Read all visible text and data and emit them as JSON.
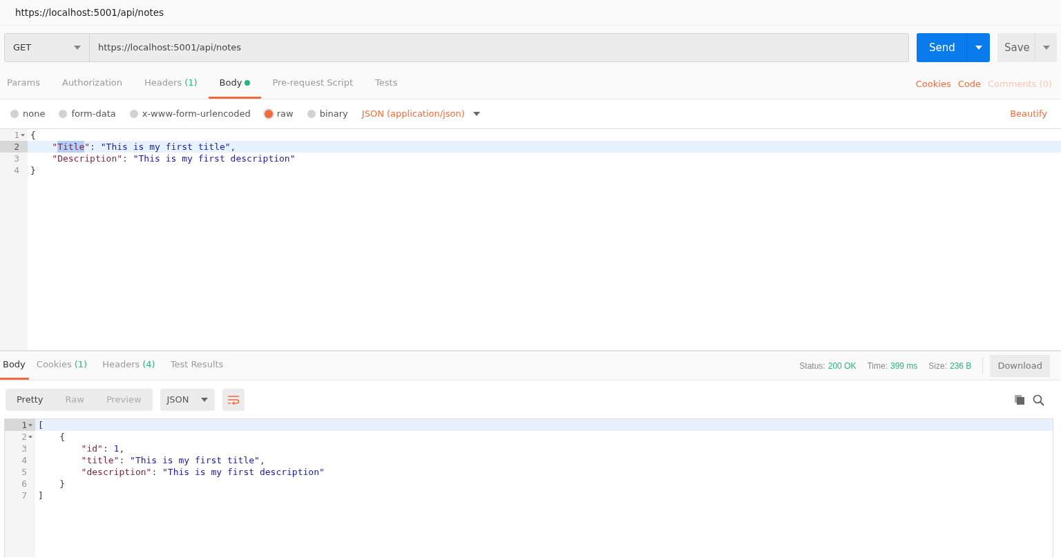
{
  "window": {
    "title": "https://localhost:5001/api/notes"
  },
  "request": {
    "method": "GET",
    "url": "https://localhost:5001/api/notes",
    "send": "Send",
    "save": "Save"
  },
  "request_tabs": [
    {
      "label": "Params",
      "selected": false,
      "dot": false
    },
    {
      "label": "Authorization",
      "selected": false,
      "dot": false
    },
    {
      "label": "Headers",
      "count": "(1)",
      "selected": false,
      "dot": false
    },
    {
      "label": "Body",
      "selected": true,
      "dot": true
    },
    {
      "label": "Pre-request Script",
      "selected": false,
      "dot": false
    },
    {
      "label": "Tests",
      "selected": false,
      "dot": false
    }
  ],
  "request_links": [
    {
      "label": "Cookies",
      "disabled": false
    },
    {
      "label": "Code",
      "disabled": false
    },
    {
      "label": "Comments (0)",
      "disabled": true
    }
  ],
  "body_types": [
    {
      "label": "none",
      "selected": false
    },
    {
      "label": "form-data",
      "selected": false
    },
    {
      "label": "x-www-form-urlencoded",
      "selected": false
    },
    {
      "label": "raw",
      "selected": true
    },
    {
      "label": "binary",
      "selected": false
    }
  ],
  "content_type": "JSON (application/json)",
  "beautify": "Beautify",
  "request_body": [
    {
      "number": "1",
      "foldable": true,
      "active": false,
      "tokens": [
        {
          "kind": "punct",
          "text": "{"
        }
      ]
    },
    {
      "number": "2",
      "foldable": false,
      "active": true,
      "tokens": [
        {
          "kind": "key",
          "text": "    \""
        },
        {
          "kind": "key",
          "text": "Title",
          "selected": true
        },
        {
          "kind": "key",
          "text": "\""
        },
        {
          "kind": "punct",
          "text": ": "
        },
        {
          "kind": "str",
          "text": "\"This is my first title\""
        },
        {
          "kind": "punct",
          "text": ","
        }
      ]
    },
    {
      "number": "3",
      "foldable": false,
      "active": false,
      "tokens": [
        {
          "kind": "key",
          "text": "    \"Description\""
        },
        {
          "kind": "punct",
          "text": ": "
        },
        {
          "kind": "str",
          "text": "\"This is my first description\""
        }
      ]
    },
    {
      "number": "4",
      "foldable": false,
      "active": false,
      "tokens": [
        {
          "kind": "punct",
          "text": "}"
        }
      ]
    }
  ],
  "response_tabs": [
    {
      "label": "Body",
      "selected": true
    },
    {
      "label": "Cookies",
      "count": "(1)",
      "selected": false
    },
    {
      "label": "Headers",
      "count": "(4)",
      "selected": false
    },
    {
      "label": "Test Results",
      "selected": false
    }
  ],
  "response_meta": [
    {
      "label": "Status:",
      "value": "200 OK"
    },
    {
      "label": "Time:",
      "value": "399 ms"
    },
    {
      "label": "Size:",
      "value": "236 B"
    }
  ],
  "download": "Download",
  "view_modes": [
    {
      "label": "Pretty",
      "selected": true
    },
    {
      "label": "Raw",
      "selected": false
    },
    {
      "label": "Preview",
      "selected": false
    }
  ],
  "format": "JSON",
  "response_body": [
    {
      "number": "1",
      "foldable": true,
      "active": true,
      "tokens": [
        {
          "kind": "punct",
          "text": "["
        }
      ]
    },
    {
      "number": "2",
      "foldable": true,
      "active": false,
      "tokens": [
        {
          "kind": "punct",
          "text": "    {"
        }
      ]
    },
    {
      "number": "3",
      "foldable": false,
      "active": false,
      "tokens": [
        {
          "kind": "key",
          "text": "        \"id\""
        },
        {
          "kind": "punct",
          "text": ": "
        },
        {
          "kind": "num",
          "text": "1"
        },
        {
          "kind": "punct",
          "text": ","
        }
      ]
    },
    {
      "number": "4",
      "foldable": false,
      "active": false,
      "tokens": [
        {
          "kind": "key",
          "text": "        \"title\""
        },
        {
          "kind": "punct",
          "text": ": "
        },
        {
          "kind": "str",
          "text": "\"This is my first title\""
        },
        {
          "kind": "punct",
          "text": ","
        }
      ]
    },
    {
      "number": "5",
      "foldable": false,
      "active": false,
      "tokens": [
        {
          "kind": "key",
          "text": "        \"description\""
        },
        {
          "kind": "punct",
          "text": ": "
        },
        {
          "kind": "str",
          "text": "\"This is my first description\""
        }
      ]
    },
    {
      "number": "6",
      "foldable": false,
      "active": false,
      "tokens": [
        {
          "kind": "punct",
          "text": "    }"
        }
      ]
    },
    {
      "number": "7",
      "foldable": false,
      "active": false,
      "tokens": [
        {
          "kind": "punct",
          "text": "]"
        }
      ]
    }
  ]
}
